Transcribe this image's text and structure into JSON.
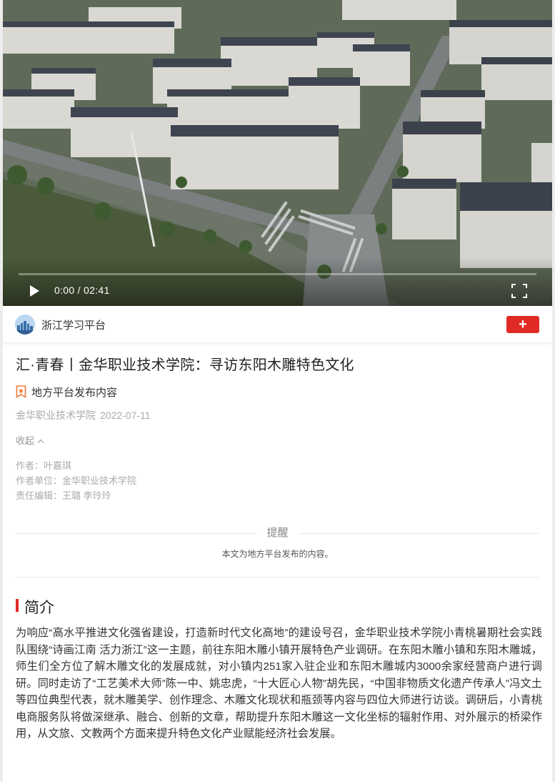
{
  "video": {
    "current_time": "0:00",
    "duration": "02:41",
    "time_display": "0:00 / 02:41",
    "progress": 0
  },
  "source": {
    "name": "浙江学习平台",
    "follow_label": "+"
  },
  "article": {
    "title": "汇·青春丨金华职业技术学院：寻访东阳木雕特色文化",
    "badge": "地方平台发布内容",
    "publisher": "金华职业技术学院",
    "date": "2022-07-11",
    "collapse_label": "收起",
    "author": "作者：叶嘉琪",
    "author_unit": "作者单位：金华职业技术学院",
    "editor": "责任编辑：王璐 李玲玲"
  },
  "notice": {
    "title": "提醒",
    "body": "本文为地方平台发布的内容。"
  },
  "section": {
    "title": "简介"
  },
  "body": "为响应“高水平推进文化强省建设，打造新时代文化高地”的建设号召，金华职业技术学院小青桃暑期社会实践队围绕“诗画江南 活力浙江”这一主题，前往东阳木雕小镇开展特色产业调研。在东阳木雕小镇和东阳木雕城，师生们全方位了解木雕文化的发展成就，对小镇内251家入驻企业和东阳木雕城内3000余家经营商户进行调研。同时走访了“工艺美术大师”陈一中、姚忠虎，“十大匠心人物”胡先民，“中国非物质文化遗产传承人”冯文土等四位典型代表，就木雕美学、创作理念、木雕文化现状和瓶颈等内容与四位大师进行访谈。调研后，小青桃电商服务队将做深继承、融合、创新的文章，帮助提升东阳木雕这一文化坐标的辐射作用、对外展示的桥梁作用，从文旅、文教两个方面来提升特色文化产业赋能经济社会发展。",
  "colors": {
    "accent_red": "#e02a25",
    "badge_orange": "#f07a3a"
  }
}
